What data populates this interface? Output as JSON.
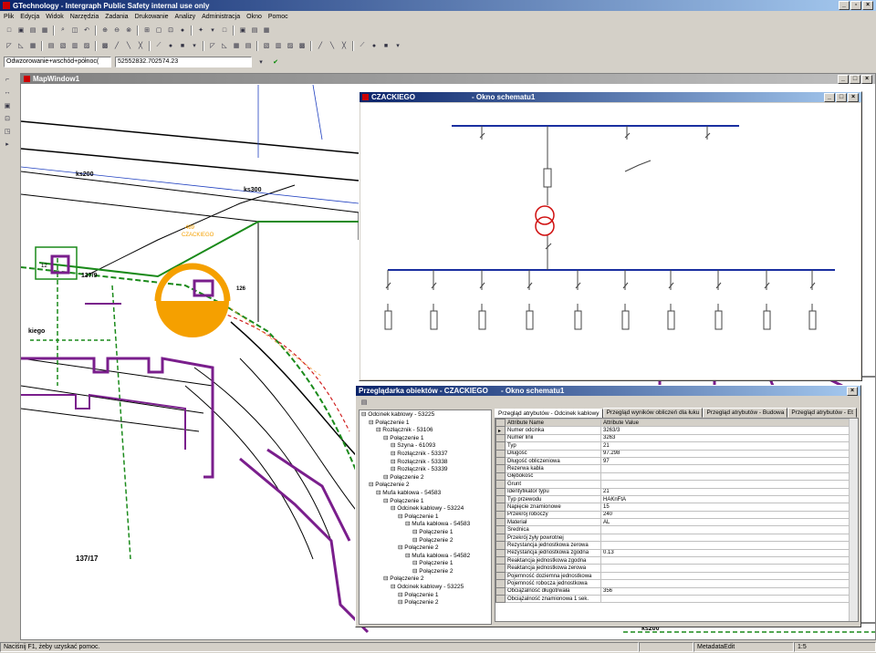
{
  "app": {
    "title": "GTechnology - Intergraph Public Safety internal use only"
  },
  "menu": [
    "Plik",
    "Edycja",
    "Widok",
    "Narzędzia",
    "Zadania",
    "Drukowanie",
    "Analizy",
    "Administracja",
    "Okno",
    "Pomoc"
  ],
  "address": {
    "combo": "Odwzorowanie+wschód+północ(",
    "coords": "52552832.702574.23"
  },
  "map_window": {
    "title": "MapWindow1"
  },
  "map_labels": {
    "ks200": "ks200",
    "ks300": "ks300",
    "ks200b": "ks200",
    "p1": "12",
    "p2": "137/9",
    "p3": "126",
    "p4": "137/17",
    "street": "kiego",
    "station_num": "489",
    "station_name": "CZACKIEGO"
  },
  "schema_window": {
    "title_left": "CZACKIEGO",
    "title_right": "- Okno schematu1"
  },
  "browser": {
    "title_left": "Przeglądarka obiektów - CZACKIEGO",
    "title_right": "- Okno schematu1",
    "tree": [
      "Odcinek kablowy - 53225",
      "Połączenie 1",
      "Rozłącznik - 53106",
      "Połączenie 1",
      "Szyna - 61093",
      "Rozłącznik - 53337",
      "Rozłącznik - 53338",
      "Rozłącznik - 53339",
      "Połączenie 2",
      "Połączenie 2",
      "Mufa kablowa - 54583",
      "Połączenie 1",
      "Odcinek kablowy - 53224",
      "Połączenie 1",
      "Mufa kablowa - 54583",
      "Połączenie 1",
      "Połączenie 2",
      "Połączenie 2",
      "Mufa kablowa - 54582",
      "Połączenie 1",
      "Połączenie 2",
      "Połączenie 2",
      "Odcinek kablowy - 53225",
      "Połączenie 1",
      "Połączenie 2"
    ],
    "tabs": [
      "Przegląd atrybutów - Odcinek kablowy",
      "Przegląd wyników obliczeń dla łuku",
      "Przegląd atrybutów - Budowa",
      "Przegląd atrybutów - Et"
    ],
    "grid_header": {
      "name": "Attribute Name",
      "value": "Attribute Value"
    },
    "grid": [
      {
        "name": "Numer odcinka",
        "value": "3263/3"
      },
      {
        "name": "Numer linii",
        "value": "3263"
      },
      {
        "name": "Typ",
        "value": "21"
      },
      {
        "name": "Długość",
        "value": "97.298"
      },
      {
        "name": "Długość obliczeniowa",
        "value": "97"
      },
      {
        "name": "Rezerwa kabla",
        "value": ""
      },
      {
        "name": "Głębokość",
        "value": ""
      },
      {
        "name": "Grunt",
        "value": ""
      },
      {
        "name": "Identyfikator typu",
        "value": "21"
      },
      {
        "name": "Typ przewodu",
        "value": "HAKnFtA"
      },
      {
        "name": "Napięcie znamionowe",
        "value": "15"
      },
      {
        "name": "Przekrój roboczy",
        "value": "240"
      },
      {
        "name": "Materiał",
        "value": "AL"
      },
      {
        "name": "Średnica",
        "value": ""
      },
      {
        "name": "Przekrój żyły powrotnej",
        "value": ""
      },
      {
        "name": "Rezystancja jednostkowa zerowa",
        "value": ""
      },
      {
        "name": "Rezystancja jednostkowa zgodna",
        "value": "0.13"
      },
      {
        "name": "Reaktancja jednostkowa zgodna",
        "value": ""
      },
      {
        "name": "Reaktancja jednostkowa zerowa",
        "value": ""
      },
      {
        "name": "Pojemność doziemna jednostkowa",
        "value": ""
      },
      {
        "name": "Pojemność robocza jednostkowa",
        "value": ""
      },
      {
        "name": "Obciążalność długotrwała",
        "value": "356"
      },
      {
        "name": "Obciążalność znamionowa 1 sek.",
        "value": ""
      }
    ]
  },
  "status": {
    "help": "Naciśnij F1, żeby uzyskać pomoc.",
    "mode": "MetadataEdit",
    "scale": "1:5"
  }
}
